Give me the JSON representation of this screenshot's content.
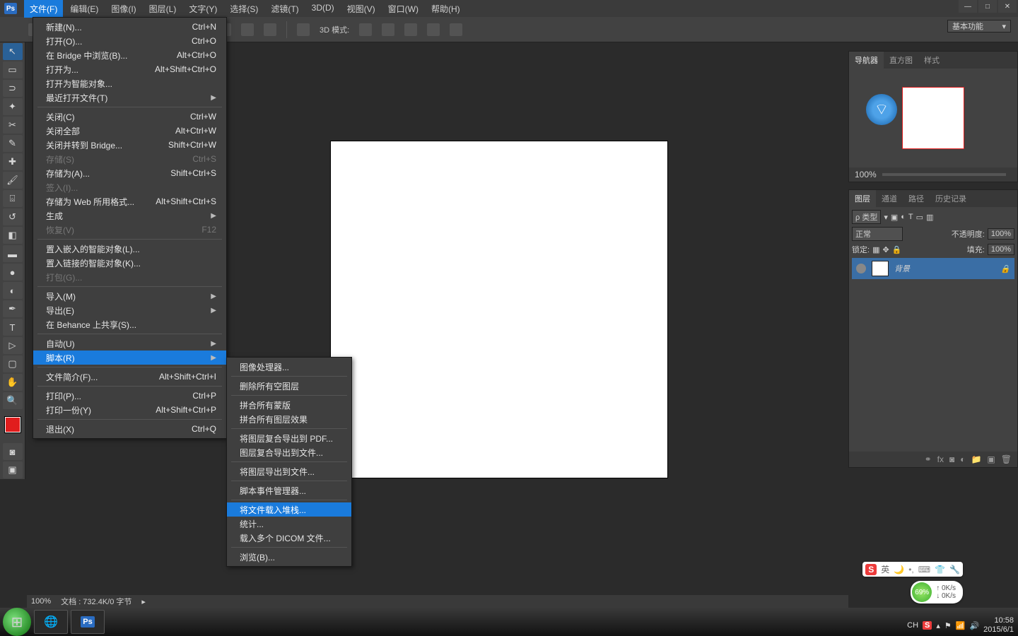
{
  "menus": [
    "文件(F)",
    "编辑(E)",
    "图像(I)",
    "图层(L)",
    "文字(Y)",
    "选择(S)",
    "滤镜(T)",
    "3D(D)",
    "视图(V)",
    "窗口(W)",
    "帮助(H)"
  ],
  "file_menu": [
    {
      "label": "新建(N)...",
      "shortcut": "Ctrl+N",
      "type": "item"
    },
    {
      "label": "打开(O)...",
      "shortcut": "Ctrl+O",
      "type": "item"
    },
    {
      "label": "在 Bridge 中浏览(B)...",
      "shortcut": "Alt+Ctrl+O",
      "type": "item"
    },
    {
      "label": "打开为...",
      "shortcut": "Alt+Shift+Ctrl+O",
      "type": "item"
    },
    {
      "label": "打开为智能对象...",
      "shortcut": "",
      "type": "item"
    },
    {
      "label": "最近打开文件(T)",
      "shortcut": "",
      "type": "sub"
    },
    {
      "type": "sep"
    },
    {
      "label": "关闭(C)",
      "shortcut": "Ctrl+W",
      "type": "item"
    },
    {
      "label": "关闭全部",
      "shortcut": "Alt+Ctrl+W",
      "type": "item"
    },
    {
      "label": "关闭并转到 Bridge...",
      "shortcut": "Shift+Ctrl+W",
      "type": "item"
    },
    {
      "label": "存储(S)",
      "shortcut": "Ctrl+S",
      "type": "item",
      "disabled": true
    },
    {
      "label": "存储为(A)...",
      "shortcut": "Shift+Ctrl+S",
      "type": "item"
    },
    {
      "label": "签入(I)...",
      "shortcut": "",
      "type": "item",
      "disabled": true
    },
    {
      "label": "存储为 Web 所用格式...",
      "shortcut": "Alt+Shift+Ctrl+S",
      "type": "item"
    },
    {
      "label": "生成",
      "shortcut": "",
      "type": "sub"
    },
    {
      "label": "恢复(V)",
      "shortcut": "F12",
      "type": "item",
      "disabled": true
    },
    {
      "type": "sep"
    },
    {
      "label": "置入嵌入的智能对象(L)...",
      "shortcut": "",
      "type": "item"
    },
    {
      "label": "置入链接的智能对象(K)...",
      "shortcut": "",
      "type": "item"
    },
    {
      "label": "打包(G)...",
      "shortcut": "",
      "type": "item",
      "disabled": true
    },
    {
      "type": "sep"
    },
    {
      "label": "导入(M)",
      "shortcut": "",
      "type": "sub"
    },
    {
      "label": "导出(E)",
      "shortcut": "",
      "type": "sub"
    },
    {
      "label": "在 Behance 上共享(S)...",
      "shortcut": "",
      "type": "item"
    },
    {
      "type": "sep"
    },
    {
      "label": "自动(U)",
      "shortcut": "",
      "type": "sub"
    },
    {
      "label": "脚本(R)",
      "shortcut": "",
      "type": "sub",
      "hover": true
    },
    {
      "type": "sep"
    },
    {
      "label": "文件简介(F)...",
      "shortcut": "Alt+Shift+Ctrl+I",
      "type": "item"
    },
    {
      "type": "sep"
    },
    {
      "label": "打印(P)...",
      "shortcut": "Ctrl+P",
      "type": "item"
    },
    {
      "label": "打印一份(Y)",
      "shortcut": "Alt+Shift+Ctrl+P",
      "type": "item"
    },
    {
      "type": "sep"
    },
    {
      "label": "退出(X)",
      "shortcut": "Ctrl+Q",
      "type": "item"
    }
  ],
  "script_submenu": [
    {
      "label": "图像处理器...",
      "type": "item"
    },
    {
      "type": "sep"
    },
    {
      "label": "删除所有空图层",
      "type": "item"
    },
    {
      "type": "sep"
    },
    {
      "label": "拼合所有蒙版",
      "type": "item"
    },
    {
      "label": "拼合所有图层效果",
      "type": "item"
    },
    {
      "type": "sep"
    },
    {
      "label": "将图层复合导出到 PDF...",
      "type": "item"
    },
    {
      "label": "图层复合导出到文件...",
      "type": "item"
    },
    {
      "type": "sep"
    },
    {
      "label": "将图层导出到文件...",
      "type": "item"
    },
    {
      "type": "sep"
    },
    {
      "label": "脚本事件管理器...",
      "type": "item"
    },
    {
      "type": "sep"
    },
    {
      "label": "将文件载入堆栈...",
      "type": "item",
      "hover": true
    },
    {
      "label": "统计...",
      "type": "item"
    },
    {
      "label": "载入多个 DICOM 文件...",
      "type": "item"
    },
    {
      "type": "sep"
    },
    {
      "label": "浏览(B)...",
      "type": "item"
    }
  ],
  "options": {
    "mode_label": "3D 模式:"
  },
  "workspace": "基本功能",
  "navigator": {
    "tabs": [
      "导航器",
      "直方图",
      "样式"
    ],
    "zoom": "100%"
  },
  "layers": {
    "tabs": [
      "图层",
      "通道",
      "路径",
      "历史记录"
    ],
    "filter_label": "ρ 类型",
    "blend": "正常",
    "opacity_label": "不透明度:",
    "opacity": "100%",
    "lock_label": "锁定:",
    "fill_label": "填充:",
    "fill": "100%",
    "layer_name": "背景"
  },
  "statusbar": {
    "zoom": "100%",
    "doc": "文档 : 732.4K/0 字节"
  },
  "taskbar": {
    "time": "10:58",
    "date": "2015/6/1",
    "ime": "CH"
  },
  "speed": {
    "pct": "69%",
    "up": "↑ 0K/s",
    "down": "↓ 0K/s"
  }
}
